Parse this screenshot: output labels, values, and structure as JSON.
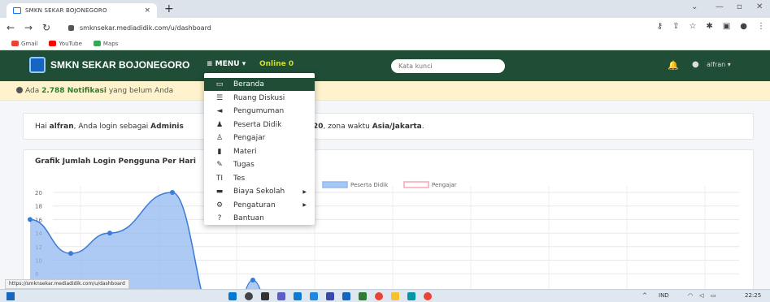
{
  "browser": {
    "tab_title": "SMKN SEKAR BOJONEGORO",
    "tab_close": "×",
    "new_tab": "+",
    "url": "smknsekar.mediadidik.com/u/dashboard",
    "bookmarks": [
      {
        "label": "Gmail",
        "color": "#ea4335"
      },
      {
        "label": "YouTube",
        "color": "#ff0000"
      },
      {
        "label": "Maps",
        "color": "#34a853"
      }
    ],
    "status_url": "https://smknsekar.mediadidik.com/u/dashboard"
  },
  "navbar": {
    "brand": "SMKN SEKAR BOJONEGORO",
    "menu_label": "≡ MENU ▾",
    "online_label": "Online 0",
    "search_placeholder": "Kata kunci",
    "user": "alfran ▾",
    "bg_color": "#1f4d36"
  },
  "notification": {
    "prefix": "Ada ",
    "count": "2.788 Notifikasi",
    "suffix": " yang belum Anda"
  },
  "login_info": {
    "greeting": "Hai ",
    "user": "alfran",
    "text": ", Anda login sebagai ",
    "role": "Adminis",
    "after_prefix": "30.20",
    "after_text": ", zona waktu ",
    "timezone": "Asia/Jakarta",
    "after_end": "."
  },
  "menu": {
    "items": [
      {
        "label": "Beranda",
        "icon": "monitor-icon",
        "glyph": "▭",
        "active": true
      },
      {
        "label": "Ruang Diskusi",
        "icon": "database-icon",
        "glyph": "☰"
      },
      {
        "label": "Pengumuman",
        "icon": "megaphone-icon",
        "glyph": "◄"
      },
      {
        "label": "Peserta Didik",
        "icon": "users-icon",
        "glyph": "♟"
      },
      {
        "label": "Pengajar",
        "icon": "user-tie-icon",
        "glyph": "♙"
      },
      {
        "label": "Materi",
        "icon": "file-icon",
        "glyph": "▮"
      },
      {
        "label": "Tugas",
        "icon": "tasks-icon",
        "glyph": "✎"
      },
      {
        "label": "Tes",
        "icon": "text-icon",
        "glyph": "TI"
      },
      {
        "label": "Biaya Sekolah",
        "icon": "money-icon",
        "glyph": "▬",
        "submenu": true
      },
      {
        "label": "Pengaturan",
        "icon": "cogs-icon",
        "glyph": "⚙",
        "submenu": true
      },
      {
        "label": "Bantuan",
        "icon": "help-icon",
        "glyph": "?"
      }
    ]
  },
  "chart_data": {
    "type": "line",
    "title": "Grafik Jumlah Login Pengguna Per Hari",
    "y_ticks": [
      8,
      10,
      12,
      14,
      16,
      18,
      20
    ],
    "legend": [
      "Peserta Didik",
      "Pengajar"
    ],
    "legend_colors": [
      "#90b8f0",
      "#f8a5b8"
    ],
    "series": [
      {
        "name": "Peserta Didik",
        "points": [
          {
            "x": 0,
            "y": 16
          },
          {
            "x": 1,
            "y": 11
          },
          {
            "x": 2,
            "y": 14
          },
          {
            "x": 3,
            "y": 20
          }
        ]
      }
    ]
  },
  "taskbar": {
    "lang": "IND",
    "time": "22:25"
  }
}
